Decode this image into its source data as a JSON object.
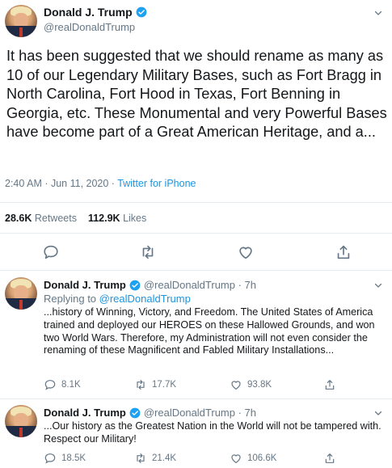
{
  "main_tweet": {
    "name": "Donald J. Trump",
    "handle": "@realDonaldTrump",
    "text": "It has been suggested that we should rename as many as 10 of our Legendary Military Bases, such as Fort Bragg in North Carolina, Fort Hood in Texas, Fort Benning in Georgia, etc. These Monumental and very Powerful Bases have become part of a Great American Heritage, and a...",
    "timestamp": "2:40 AM · Jun 11, 2020 · ",
    "source": "Twitter for iPhone",
    "retweets_count": "28.6K",
    "retweets_label": "Retweets",
    "likes_count": "112.9K",
    "likes_label": "Likes"
  },
  "replies": [
    {
      "name": "Donald J. Trump",
      "handle": "@realDonaldTrump · 7h",
      "replying_prefix": "Replying to ",
      "replying_handle": "@realDonaldTrump",
      "text": "...history of Winning, Victory, and Freedom. The United States of America trained and deployed our HEROES on these Hallowed Grounds, and won two World Wars. Therefore, my Administration will not even consider the renaming of these Magnificent and Fabled Military Installations...",
      "reply_count": "8.1K",
      "retweet_count": "17.7K",
      "like_count": "93.8K"
    },
    {
      "name": "Donald J. Trump",
      "handle": "@realDonaldTrump · 7h",
      "text": "...Our history as the Greatest Nation in the World will not be tampered with. Respect our Military!",
      "reply_count": "18.5K",
      "retweet_count": "21.4K",
      "like_count": "106.6K"
    }
  ],
  "colors": {
    "accent": "#1b95e0",
    "verified": "#1da1f2",
    "muted": "#657786",
    "divider": "#e6ecf0"
  },
  "icons": [
    "verified-badge-icon",
    "chevron-down-icon",
    "reply-icon",
    "retweet-icon",
    "like-icon",
    "share-icon"
  ]
}
